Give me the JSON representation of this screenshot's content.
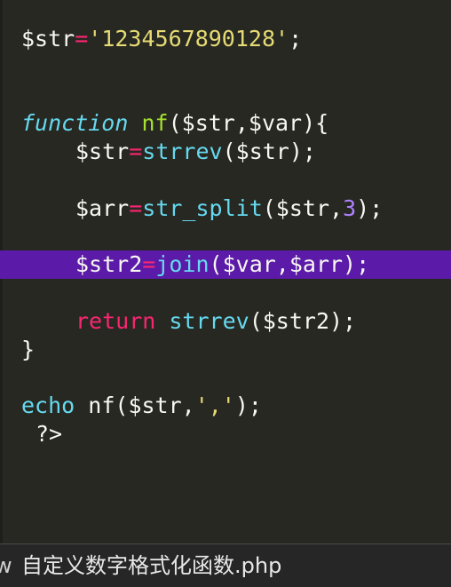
{
  "code": {
    "line1": {
      "var": "$str",
      "op": "=",
      "str": "'1234567890128'",
      "end": ";"
    },
    "line2": {
      "keyword": "function",
      "name": "nf",
      "params": "($str,$var){"
    },
    "line3": {
      "var": "$str",
      "op": "=",
      "fn": "strrev",
      "args": "($str);"
    },
    "line4": {
      "var": "$arr",
      "op": "=",
      "fn": "str_split",
      "args_open": "($str,",
      "num": "3",
      "args_close": ");"
    },
    "line5": {
      "var": "$str2",
      "op": "=",
      "fn": "join",
      "args": "($var,$arr);"
    },
    "line6": {
      "keyword": "return",
      "fn": "strrev",
      "args": "($str2);"
    },
    "line7": {
      "text": "}"
    },
    "line8": {
      "keyword": "echo",
      "fn": "nf",
      "args_open": "($str,",
      "str": "','",
      "args_close": ");"
    },
    "line9": {
      "text": "?>"
    }
  },
  "statusbar": {
    "prefix": "w",
    "filename": "自定义数字格式化函数.php"
  },
  "colors": {
    "background": "#272822",
    "highlight": "#5b1aa7",
    "string": "#e6db74",
    "keyword": "#f92672",
    "function": "#66d9ef",
    "name": "#a6e22e",
    "number": "#ae81ff"
  }
}
